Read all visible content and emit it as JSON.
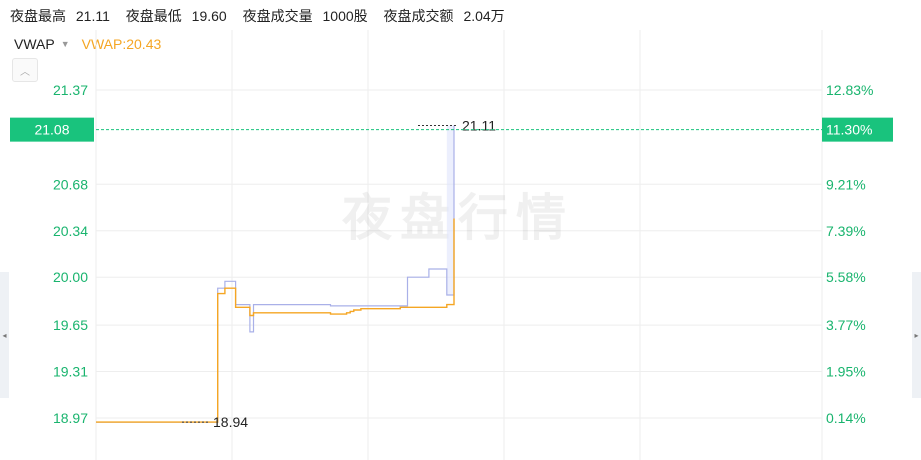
{
  "header": {
    "stats": [
      {
        "label": "夜盘最高",
        "value": "21.11"
      },
      {
        "label": "夜盘最低",
        "value": "19.60"
      },
      {
        "label": "夜盘成交量",
        "value": "1000股"
      },
      {
        "label": "夜盘成交额",
        "value": "2.04万"
      }
    ]
  },
  "indicator": {
    "name": "VWAP",
    "value_text": "VWAP:20.43"
  },
  "watermark": "夜盘行情",
  "colors": {
    "price_line": "#a9b0e8",
    "vwap_line": "#f5a623",
    "tick_text": "#19b46e",
    "current_tag": "#19c37d",
    "grid": "#eeeeee"
  },
  "icons": {
    "collapse": "chevron-up-icon",
    "left_handle": "chevron-left-icon",
    "right_handle": "chevron-right-icon"
  },
  "chart_data": {
    "type": "line",
    "ylim": [
      18.97,
      21.37
    ],
    "y_ticks": [
      "21.37",
      "20.68",
      "20.34",
      "20.00",
      "19.65",
      "19.31",
      "18.97"
    ],
    "right_ticks": [
      "12.83%",
      "9.21%",
      "7.39%",
      "5.58%",
      "3.77%",
      "1.95%",
      "0.14%"
    ],
    "y_tick_values": [
      21.37,
      20.68,
      20.34,
      20.0,
      19.65,
      19.31,
      18.97
    ],
    "x": [
      0,
      0.08,
      0.08,
      0.1,
      0.1,
      0.12,
      0.125,
      0.135,
      0.14,
      0.145,
      0.16,
      0.17,
      0.175,
      0.185,
      0.19,
      0.24,
      0.25,
      0.3,
      0.31,
      0.32,
      0.325,
      0.33,
      0.34,
      0.345,
      0.36,
      0.38,
      0.39,
      0.4,
      0.43,
      0.435,
      0.44,
      0.47,
      0.48,
      0.49,
      0.5,
      0.51,
      0.52,
      0.53,
      0.54,
      0.65,
      0.655,
      0.7,
      0.71,
      0.72,
      0.73,
      0.74,
      0.745,
      0.75,
      0.76,
      0.77,
      0.8,
      0.83,
      0.84,
      0.85,
      0.86,
      0.865,
      0.87,
      0.88,
      0.93,
      0.935,
      0.98,
      1.0
    ],
    "series": [
      {
        "key": "price",
        "values": [
          18.94,
          18.94,
          18.94,
          18.94,
          18.94,
          18.94,
          18.94,
          18.94,
          18.94,
          18.94,
          18.94,
          18.94,
          18.94,
          18.94,
          18.94,
          18.94,
          18.94,
          18.94,
          18.94,
          18.94,
          18.94,
          18.94,
          19.92,
          19.92,
          19.97,
          19.97,
          19.8,
          19.8,
          19.6,
          19.6,
          19.8,
          19.8,
          19.8,
          19.8,
          19.8,
          19.8,
          19.8,
          19.8,
          19.8,
          19.8,
          19.79,
          19.79,
          19.79,
          19.79,
          19.79,
          19.79,
          19.79,
          19.79,
          19.79,
          19.79,
          19.79,
          19.79,
          19.79,
          19.79,
          19.79,
          19.79,
          20.0,
          20.0,
          20.06,
          20.06,
          19.87,
          21.11
        ]
      },
      {
        "key": "vwap",
        "values": [
          18.94,
          18.94,
          18.94,
          18.94,
          18.94,
          18.94,
          18.94,
          18.94,
          18.94,
          18.94,
          18.94,
          18.94,
          18.94,
          18.94,
          18.94,
          18.94,
          18.94,
          18.94,
          18.94,
          18.94,
          18.94,
          18.94,
          19.88,
          19.88,
          19.92,
          19.92,
          19.78,
          19.78,
          19.72,
          19.72,
          19.74,
          19.74,
          19.74,
          19.74,
          19.74,
          19.74,
          19.74,
          19.74,
          19.74,
          19.74,
          19.73,
          19.74,
          19.75,
          19.76,
          19.76,
          19.77,
          19.77,
          19.77,
          19.77,
          19.77,
          19.77,
          19.77,
          19.77,
          19.78,
          19.78,
          19.78,
          19.78,
          19.78,
          19.78,
          19.78,
          19.8,
          20.43
        ]
      }
    ],
    "high_label": "21.11",
    "low_label": "18.94",
    "current": {
      "price": "21.08",
      "pct": "11.30%"
    }
  }
}
